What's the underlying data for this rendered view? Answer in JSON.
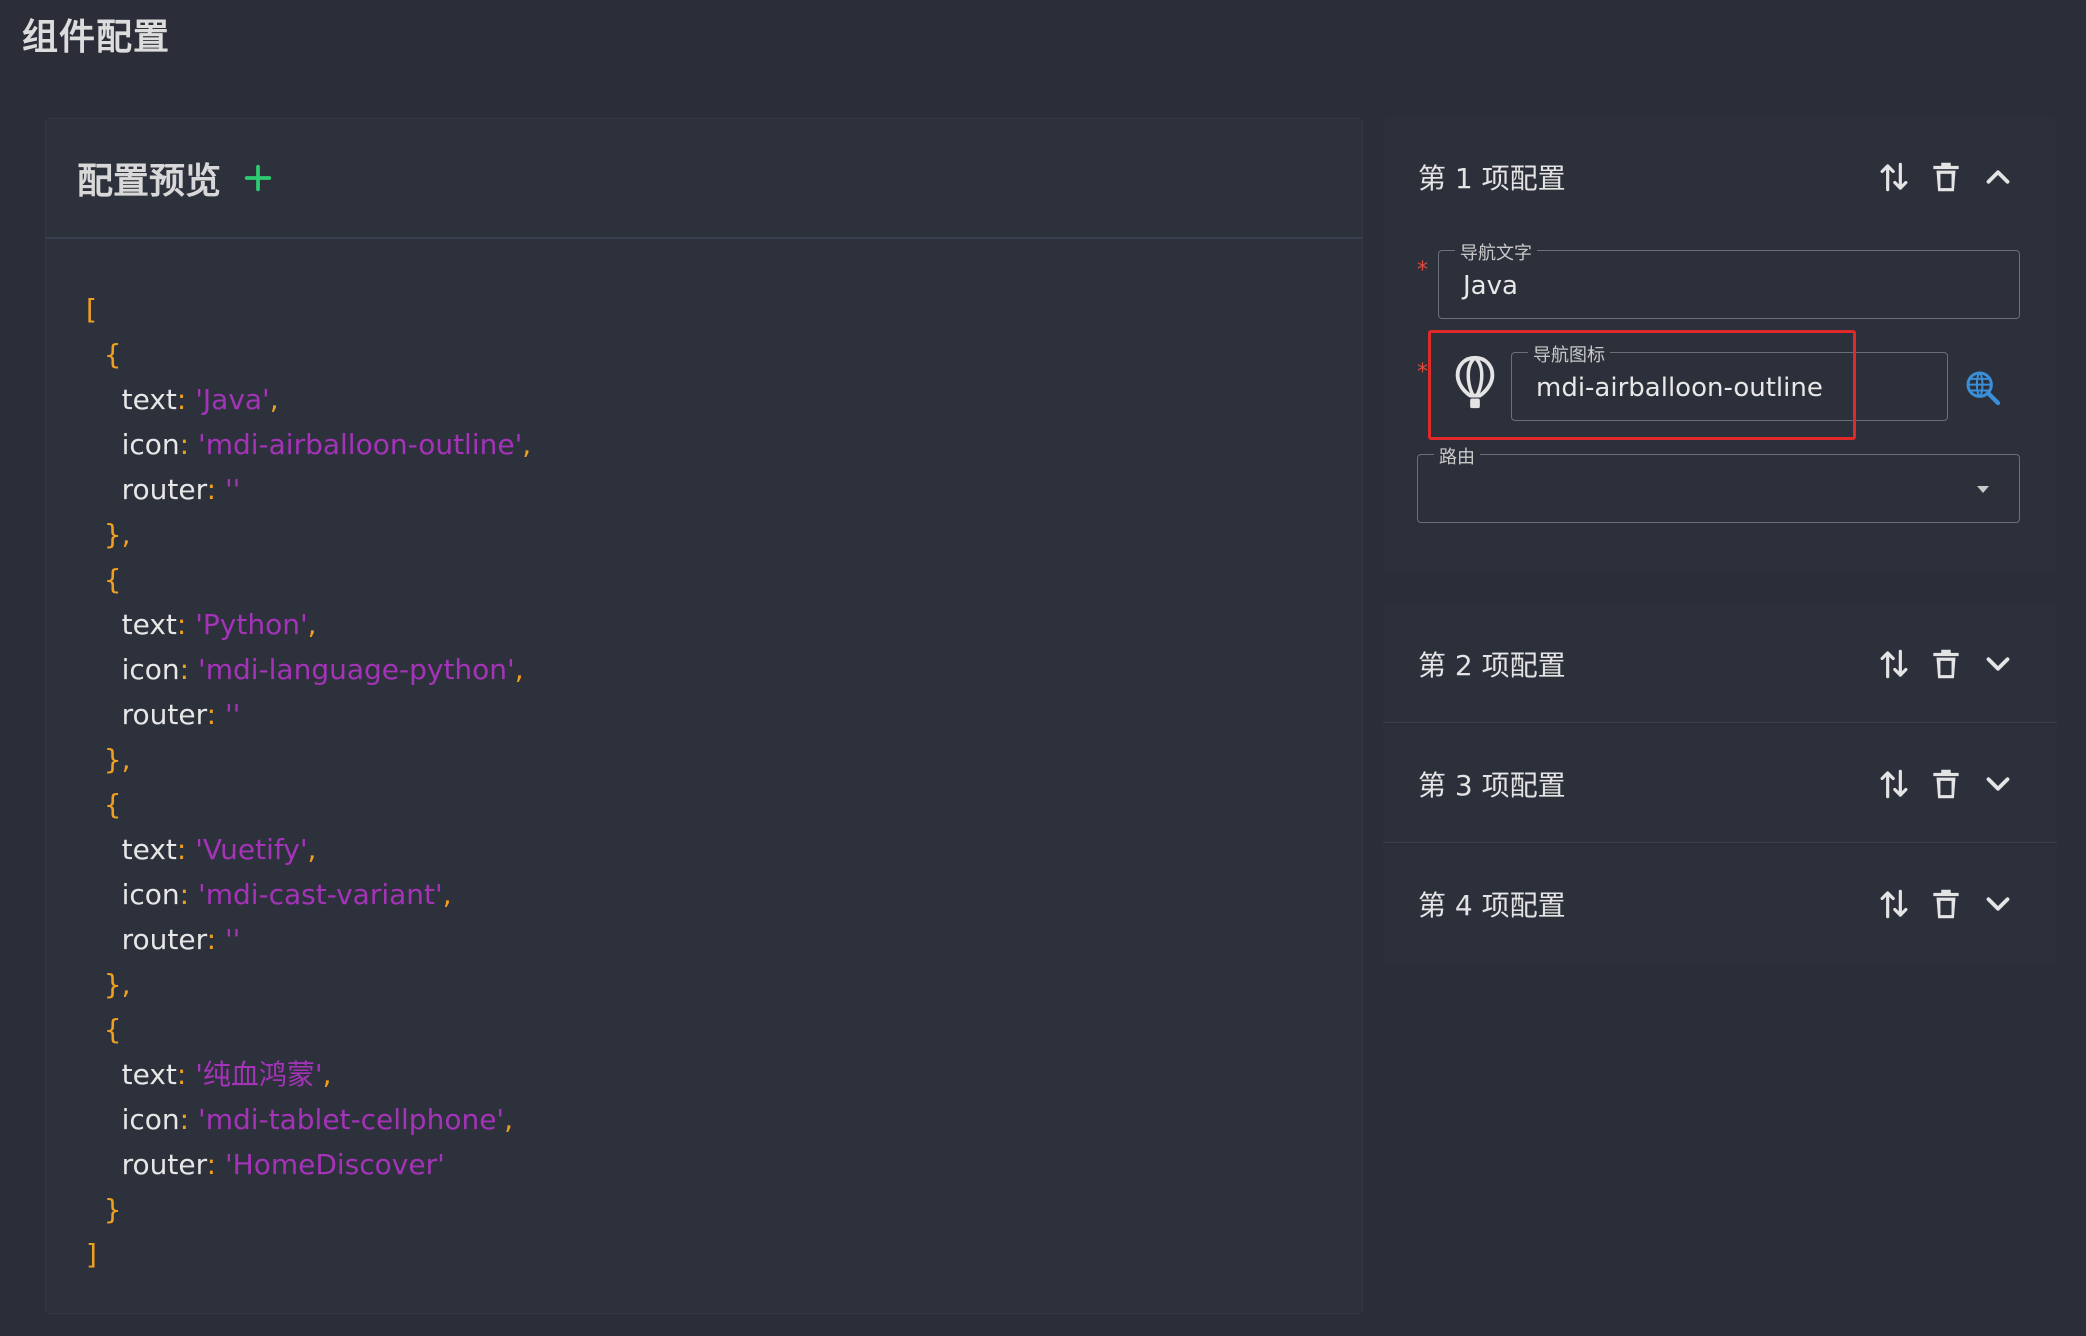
{
  "page": {
    "title": "组件配置"
  },
  "preview": {
    "title": "配置预览",
    "code": [
      [
        {
          "t": "punct",
          "v": "["
        }
      ],
      [
        {
          "t": "punct",
          "v": "  {"
        }
      ],
      [
        {
          "t": "key",
          "v": "    text"
        },
        {
          "t": "colon",
          "v": ": "
        },
        {
          "t": "str",
          "v": "'Java'"
        },
        {
          "t": "comma",
          "v": ","
        }
      ],
      [
        {
          "t": "key",
          "v": "    icon"
        },
        {
          "t": "colon",
          "v": ": "
        },
        {
          "t": "str",
          "v": "'mdi-airballoon-outline'"
        },
        {
          "t": "comma",
          "v": ","
        }
      ],
      [
        {
          "t": "key",
          "v": "    router"
        },
        {
          "t": "colon",
          "v": ": "
        },
        {
          "t": "str",
          "v": "''"
        }
      ],
      [
        {
          "t": "punct",
          "v": "  },"
        }
      ],
      [
        {
          "t": "punct",
          "v": "  {"
        }
      ],
      [
        {
          "t": "key",
          "v": "    text"
        },
        {
          "t": "colon",
          "v": ": "
        },
        {
          "t": "str",
          "v": "'Python'"
        },
        {
          "t": "comma",
          "v": ","
        }
      ],
      [
        {
          "t": "key",
          "v": "    icon"
        },
        {
          "t": "colon",
          "v": ": "
        },
        {
          "t": "str",
          "v": "'mdi-language-python'"
        },
        {
          "t": "comma",
          "v": ","
        }
      ],
      [
        {
          "t": "key",
          "v": "    router"
        },
        {
          "t": "colon",
          "v": ": "
        },
        {
          "t": "str",
          "v": "''"
        }
      ],
      [
        {
          "t": "punct",
          "v": "  },"
        }
      ],
      [
        {
          "t": "punct",
          "v": "  {"
        }
      ],
      [
        {
          "t": "key",
          "v": "    text"
        },
        {
          "t": "colon",
          "v": ": "
        },
        {
          "t": "str",
          "v": "'Vuetify'"
        },
        {
          "t": "comma",
          "v": ","
        }
      ],
      [
        {
          "t": "key",
          "v": "    icon"
        },
        {
          "t": "colon",
          "v": ": "
        },
        {
          "t": "str",
          "v": "'mdi-cast-variant'"
        },
        {
          "t": "comma",
          "v": ","
        }
      ],
      [
        {
          "t": "key",
          "v": "    router"
        },
        {
          "t": "colon",
          "v": ": "
        },
        {
          "t": "str",
          "v": "''"
        }
      ],
      [
        {
          "t": "punct",
          "v": "  },"
        }
      ],
      [
        {
          "t": "punct",
          "v": "  {"
        }
      ],
      [
        {
          "t": "key",
          "v": "    text"
        },
        {
          "t": "colon",
          "v": ": "
        },
        {
          "t": "str",
          "v": "'纯血鸿蒙'"
        },
        {
          "t": "comma",
          "v": ","
        }
      ],
      [
        {
          "t": "key",
          "v": "    icon"
        },
        {
          "t": "colon",
          "v": ": "
        },
        {
          "t": "str",
          "v": "'mdi-tablet-cellphone'"
        },
        {
          "t": "comma",
          "v": ","
        }
      ],
      [
        {
          "t": "key",
          "v": "    router"
        },
        {
          "t": "colon",
          "v": ": "
        },
        {
          "t": "str",
          "v": "'HomeDiscover'"
        }
      ],
      [
        {
          "t": "punct",
          "v": "  }"
        }
      ],
      [
        {
          "t": "punct",
          "v": "]"
        }
      ]
    ]
  },
  "items": [
    {
      "label": "第 1 项配置",
      "expanded": true,
      "fields": {
        "nav_text": {
          "label": "导航文字",
          "value": "Java"
        },
        "nav_icon": {
          "label": "导航图标",
          "value": "mdi-airballoon-outline"
        },
        "route": {
          "label": "路由",
          "value": ""
        }
      }
    },
    {
      "label": "第 2 项配置",
      "expanded": false
    },
    {
      "label": "第 3 项配置",
      "expanded": false
    },
    {
      "label": "第 4 项配置",
      "expanded": false
    }
  ],
  "colors": {
    "background": "#2b2e39",
    "accent_plus": "#2ecc71",
    "string": "#a433b8",
    "punctuation": "#f0a020",
    "required": "#e24a3b",
    "highlight": "#e02a2a",
    "search_icon": "#3a8fd8"
  },
  "icons": {
    "add": "plus-icon",
    "move": "swap-vertical-icon",
    "delete": "trash-icon",
    "expand": "chevron-down-icon",
    "collapse": "chevron-up-icon",
    "balloon": "airballoon-outline-icon",
    "search": "web-search-icon",
    "dropdown": "menu-down-icon"
  }
}
